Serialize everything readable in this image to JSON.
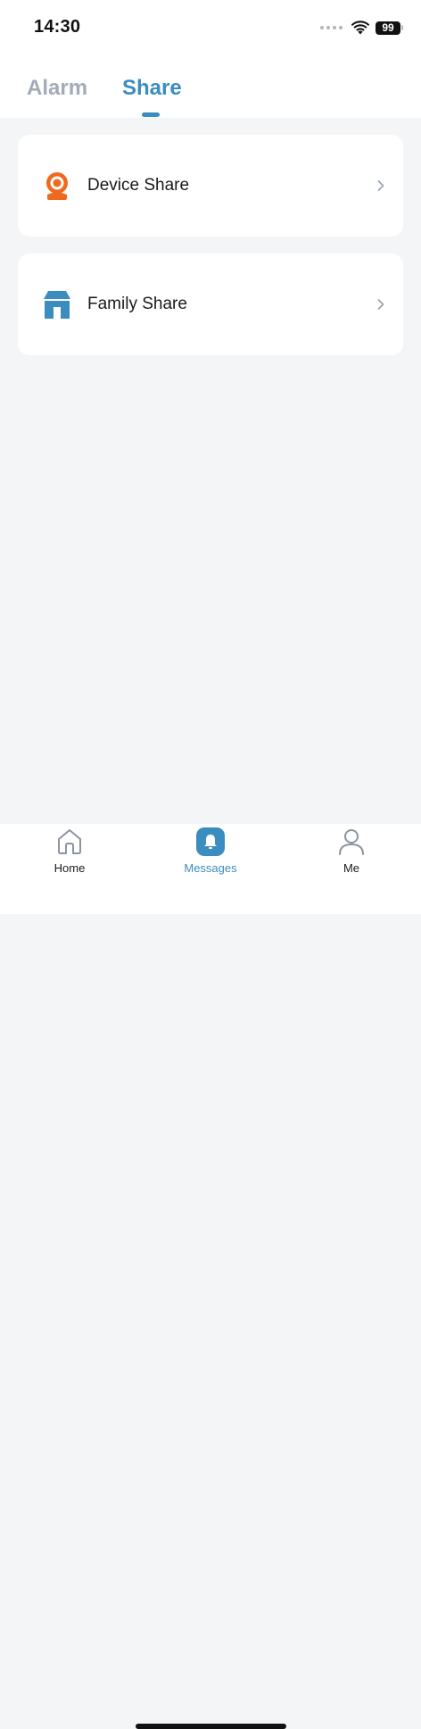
{
  "status_bar": {
    "time": "14:30",
    "battery": "99",
    "icons": [
      "signal-dots-icon",
      "wifi-icon",
      "battery-icon"
    ]
  },
  "tabs": [
    {
      "label": "Alarm",
      "active": false
    },
    {
      "label": "Share",
      "active": true
    }
  ],
  "cards": [
    {
      "label": "Device Share",
      "icon": "camera-icon"
    },
    {
      "label": "Family Share",
      "icon": "house-icon"
    }
  ],
  "bottom_nav": [
    {
      "label": "Home",
      "icon": "home-icon",
      "active": false
    },
    {
      "label": "Messages",
      "icon": "bell-icon",
      "active": true
    },
    {
      "label": "Me",
      "icon": "person-icon",
      "active": false
    }
  ],
  "colors": {
    "accent": "#3b8cbf",
    "inactive_tab": "#a3aab8",
    "camera_orange": "#f06a1e",
    "background": "#f4f5f7"
  }
}
